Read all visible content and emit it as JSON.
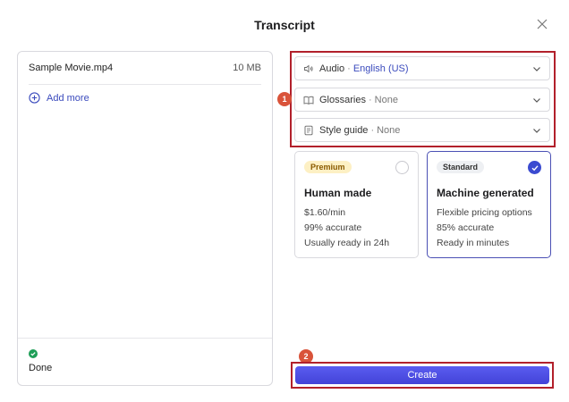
{
  "dialog": {
    "title": "Transcript"
  },
  "file": {
    "name": "Sample Movie.mp4",
    "size": "10 MB"
  },
  "add_more": {
    "label": "Add more"
  },
  "status": {
    "label": "Done",
    "color": "#1e9e57"
  },
  "selectors": {
    "audio": {
      "label": "Audio",
      "separator": "·",
      "value": "English (US)"
    },
    "glossaries": {
      "label": "Glossaries",
      "separator": "·",
      "value": "None"
    },
    "style_guide": {
      "label": "Style guide",
      "separator": "·",
      "value": "None"
    }
  },
  "cards": {
    "human": {
      "badge": "Premium",
      "name": "Human made",
      "lines": [
        "$1.60/min",
        "99% accurate",
        "Usually ready in 24h"
      ],
      "selected": false
    },
    "machine": {
      "badge": "Standard",
      "name": "Machine generated",
      "lines": [
        "Flexible pricing options",
        "85% accurate",
        "Ready in minutes"
      ],
      "selected": true
    }
  },
  "annotations": {
    "marker_1": "1",
    "marker_2": "2"
  },
  "create_button": {
    "label": "Create"
  },
  "colors": {
    "accent": "#3b4bbd",
    "primary_button": "#4a4de0",
    "highlight": "#b2202b",
    "marker": "#d9533a"
  }
}
